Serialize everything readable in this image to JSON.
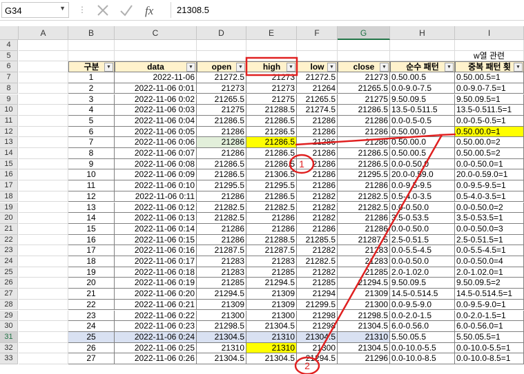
{
  "formula_bar": {
    "name_box": "G34",
    "formula": "21308.5"
  },
  "columns": [
    "A",
    "B",
    "C",
    "D",
    "E",
    "F",
    "G",
    "H",
    "I"
  ],
  "row_numbers": [
    "4",
    "5",
    "6",
    "7",
    "8",
    "9",
    "10",
    "11",
    "12",
    "13",
    "14",
    "15",
    "16",
    "17",
    "18",
    "19",
    "20",
    "21",
    "22",
    "23",
    "24",
    "25",
    "26",
    "27",
    "28",
    "29",
    "30",
    "31",
    "32",
    "33"
  ],
  "note_I5": "w열 관련",
  "headers": [
    "구분",
    "data",
    "open",
    "high",
    "low",
    "close",
    "순수 패턴",
    "중복 패턴 횟"
  ],
  "rows": [
    [
      "1",
      "2022-11-06",
      "21272.5",
      "21273",
      "21272.5",
      "21273",
      "0.50.00.5",
      "0.50.00.5=1"
    ],
    [
      "2",
      "2022-11-06 0:01",
      "21273",
      "21273",
      "21264",
      "21265.5",
      "0.0-9.0-7.5",
      "0.0-9.0-7.5=1"
    ],
    [
      "3",
      "2022-11-06 0:02",
      "21265.5",
      "21275",
      "21265.5",
      "21275",
      "9.50.09.5",
      "9.50.09.5=1"
    ],
    [
      "4",
      "2022-11-06 0:03",
      "21275",
      "21288.5",
      "21274.5",
      "21286.5",
      "13.5-0.511.5",
      "13.5-0.511.5=1"
    ],
    [
      "5",
      "2022-11-06 0:04",
      "21286.5",
      "21286.5",
      "21286",
      "21286",
      "0.0-0.5-0.5",
      "0.0-0.5-0.5=1"
    ],
    [
      "6",
      "2022-11-06 0:05",
      "21286",
      "21286.5",
      "21286",
      "21286",
      "0.50.00.0",
      "0.50.00.0=1"
    ],
    [
      "7",
      "2022-11-06 0:06",
      "21286",
      "21286.5",
      "21286",
      "21286",
      "0.50.00.0",
      "0.50.00.0=2"
    ],
    [
      "8",
      "2022-11-06 0:07",
      "21286",
      "21286.5",
      "21286",
      "21286.5",
      "0.50.00.5",
      "0.50.00.5=2"
    ],
    [
      "9",
      "2022-11-06 0:08",
      "21286.5",
      "21286.5",
      "21286",
      "21286.5",
      "0.0-0.50.0",
      "0.0-0.50.0=1"
    ],
    [
      "10",
      "2022-11-06 0:09",
      "21286.5",
      "21306.5",
      "21286",
      "21295.5",
      "20.0-0.59.0",
      "20.0-0.59.0=1"
    ],
    [
      "11",
      "2022-11-06 0:10",
      "21295.5",
      "21295.5",
      "21286",
      "21286",
      "0.0-9.5-9.5",
      "0.0-9.5-9.5=1"
    ],
    [
      "12",
      "2022-11-06 0:11",
      "21286",
      "21286.5",
      "21282",
      "21282.5",
      "0.5-4.0-3.5",
      "0.5-4.0-3.5=1"
    ],
    [
      "13",
      "2022-11-06 0:12",
      "21282.5",
      "21282.5",
      "21282",
      "21282.5",
      "0.0-0.50.0",
      "0.0-0.50.0=2"
    ],
    [
      "14",
      "2022-11-06 0:13",
      "21282.5",
      "21286",
      "21282",
      "21286",
      "3.5-0.53.5",
      "3.5-0.53.5=1"
    ],
    [
      "15",
      "2022-11-06 0:14",
      "21286",
      "21286",
      "21286",
      "21286",
      "0.0-0.50.0",
      "0.0-0.50.0=3"
    ],
    [
      "16",
      "2022-11-06 0:15",
      "21286",
      "21288.5",
      "21285.5",
      "21287.5",
      "2.5-0.51.5",
      "2.5-0.51.5=1"
    ],
    [
      "17",
      "2022-11-06 0:16",
      "21287.5",
      "21287.5",
      "21282",
      "21283",
      "0.0-5.5-4.5",
      "0.0-5.5-4.5=1"
    ],
    [
      "18",
      "2022-11-06 0:17",
      "21283",
      "21283",
      "21282.5",
      "21283",
      "0.0-0.50.0",
      "0.0-0.50.0=4"
    ],
    [
      "19",
      "2022-11-06 0:18",
      "21283",
      "21285",
      "21282",
      "21285",
      "2.0-1.02.0",
      "2.0-1.02.0=1"
    ],
    [
      "20",
      "2022-11-06 0:19",
      "21285",
      "21294.5",
      "21285",
      "21294.5",
      "9.50.09.5",
      "9.50.09.5=2"
    ],
    [
      "21",
      "2022-11-06 0:20",
      "21294.5",
      "21309",
      "21294",
      "21309",
      "14.5-0.514.5",
      "14.5-0.514.5=1"
    ],
    [
      "22",
      "2022-11-06 0:21",
      "21309",
      "21309",
      "21299.5",
      "21300",
      "0.0-9.5-9.0",
      "0.0-9.5-9.0=1"
    ],
    [
      "23",
      "2022-11-06 0:22",
      "21300",
      "21300",
      "21298",
      "21298.5",
      "0.0-2.0-1.5",
      "0.0-2.0-1.5=1"
    ],
    [
      "24",
      "2022-11-06 0:23",
      "21298.5",
      "21304.5",
      "21298",
      "21304.5",
      "6.0-0.56.0",
      "6.0-0.56.0=1"
    ],
    [
      "25",
      "2022-11-06 0:24",
      "21304.5",
      "21310",
      "21304.5",
      "21310",
      "5.50.05.5",
      "5.50.05.5=1"
    ],
    [
      "26",
      "2022-11-06 0:25",
      "21310",
      "21310",
      "21300",
      "21304.5",
      "0.0-10.0-5.5",
      "0.0-10.0-5.5=1"
    ],
    [
      "27",
      "2022-11-06 0:26",
      "21304.5",
      "21304.5",
      "21294.5",
      "21296",
      "0.0-10.0-8.5",
      "0.0-10.0-8.5=1"
    ]
  ],
  "annotations": {
    "circle_1": "1",
    "circle_2": "2"
  },
  "colors": {
    "header_fill": "#fff2cc",
    "highlight_yellow": "#ffff00",
    "highlight_green": "#e2efda",
    "annotation_red": "#e02020",
    "selected_row": "#d9e1f2"
  }
}
